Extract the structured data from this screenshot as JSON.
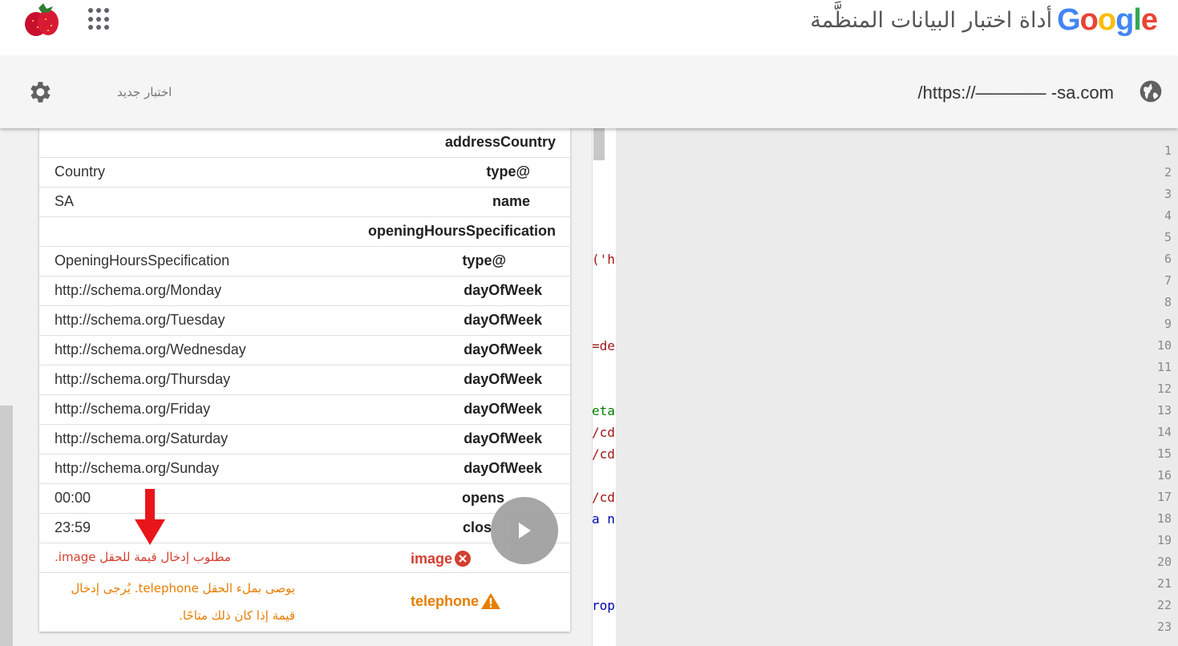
{
  "header": {
    "google_logo": {
      "letters": [
        {
          "ch": "G",
          "color": "#4285F4"
        },
        {
          "ch": "o",
          "color": "#EA4335"
        },
        {
          "ch": "o",
          "color": "#FBBC05"
        },
        {
          "ch": "g",
          "color": "#4285F4"
        },
        {
          "ch": "l",
          "color": "#34A853"
        },
        {
          "ch": "e",
          "color": "#EA4335"
        }
      ]
    },
    "title": "أداة اختبار البيانات المنظَّمة",
    "apps_icon": "apps-grid-icon",
    "avatar_icon": "strawberry-avatar"
  },
  "toolbar": {
    "new_test_label": "اختبار جديد",
    "url": "/https://———— -sa.com",
    "settings_icon": "gear-icon",
    "globe_icon": "globe-icon"
  },
  "results": {
    "rows": [
      {
        "key": "addressCountry",
        "value": ""
      },
      {
        "key": "type@",
        "value": "Country"
      },
      {
        "key": "name",
        "value": "SA"
      },
      {
        "key": "openingHoursSpecification",
        "value": ""
      },
      {
        "key": "type@",
        "value": "OpeningHoursSpecification"
      },
      {
        "key": "dayOfWeek",
        "value": "http://schema.org/Monday"
      },
      {
        "key": "dayOfWeek",
        "value": "http://schema.org/Tuesday"
      },
      {
        "key": "dayOfWeek",
        "value": "http://schema.org/Wednesday"
      },
      {
        "key": "dayOfWeek",
        "value": "http://schema.org/Thursday"
      },
      {
        "key": "dayOfWeek",
        "value": "http://schema.org/Friday"
      },
      {
        "key": "dayOfWeek",
        "value": "http://schema.org/Saturday"
      },
      {
        "key": "dayOfWeek",
        "value": "http://schema.org/Sunday"
      },
      {
        "key": "opens",
        "value": "00:00"
      },
      {
        "key": "clos",
        "value": "23:59"
      }
    ],
    "error": {
      "key": "image",
      "message": "مطلوب إدخال قيمة للحقل image.",
      "icon": "error-x-icon",
      "color": "#d23f31"
    },
    "warning": {
      "key": "telephone",
      "message": "يوصى بملء الحقل telephone. يُرجى إدخال قيمة إذا كان ذلك متاحًا.",
      "icon": "warning-triangle-icon",
      "color": "#e67e00"
    },
    "play_icon": "play-icon",
    "annotation_icon": "red-arrow-down-icon"
  },
  "code": {
    "fragments": [
      {
        "text": "('h",
        "line": 6,
        "color": "#a31515"
      },
      {
        "text": "=de",
        "line": 10,
        "color": "#a31515"
      },
      {
        "text": "eta",
        "line": 13,
        "color": "#008000"
      },
      {
        "text": "/cd",
        "line": 14,
        "color": "#a31515"
      },
      {
        "text": "/cd",
        "line": 15,
        "color": "#a31515"
      },
      {
        "text": "/cd",
        "line": 17,
        "color": "#a31515"
      },
      {
        "text": "a n",
        "line": 18,
        "color": "#0000aa"
      },
      {
        "text": "rop",
        "line": 22,
        "color": "#0000aa"
      }
    ],
    "line_numbers": [
      1,
      2,
      3,
      4,
      5,
      6,
      7,
      8,
      9,
      10,
      11,
      12,
      13,
      14,
      15,
      16,
      17,
      18,
      19,
      20,
      21,
      22,
      23
    ]
  }
}
